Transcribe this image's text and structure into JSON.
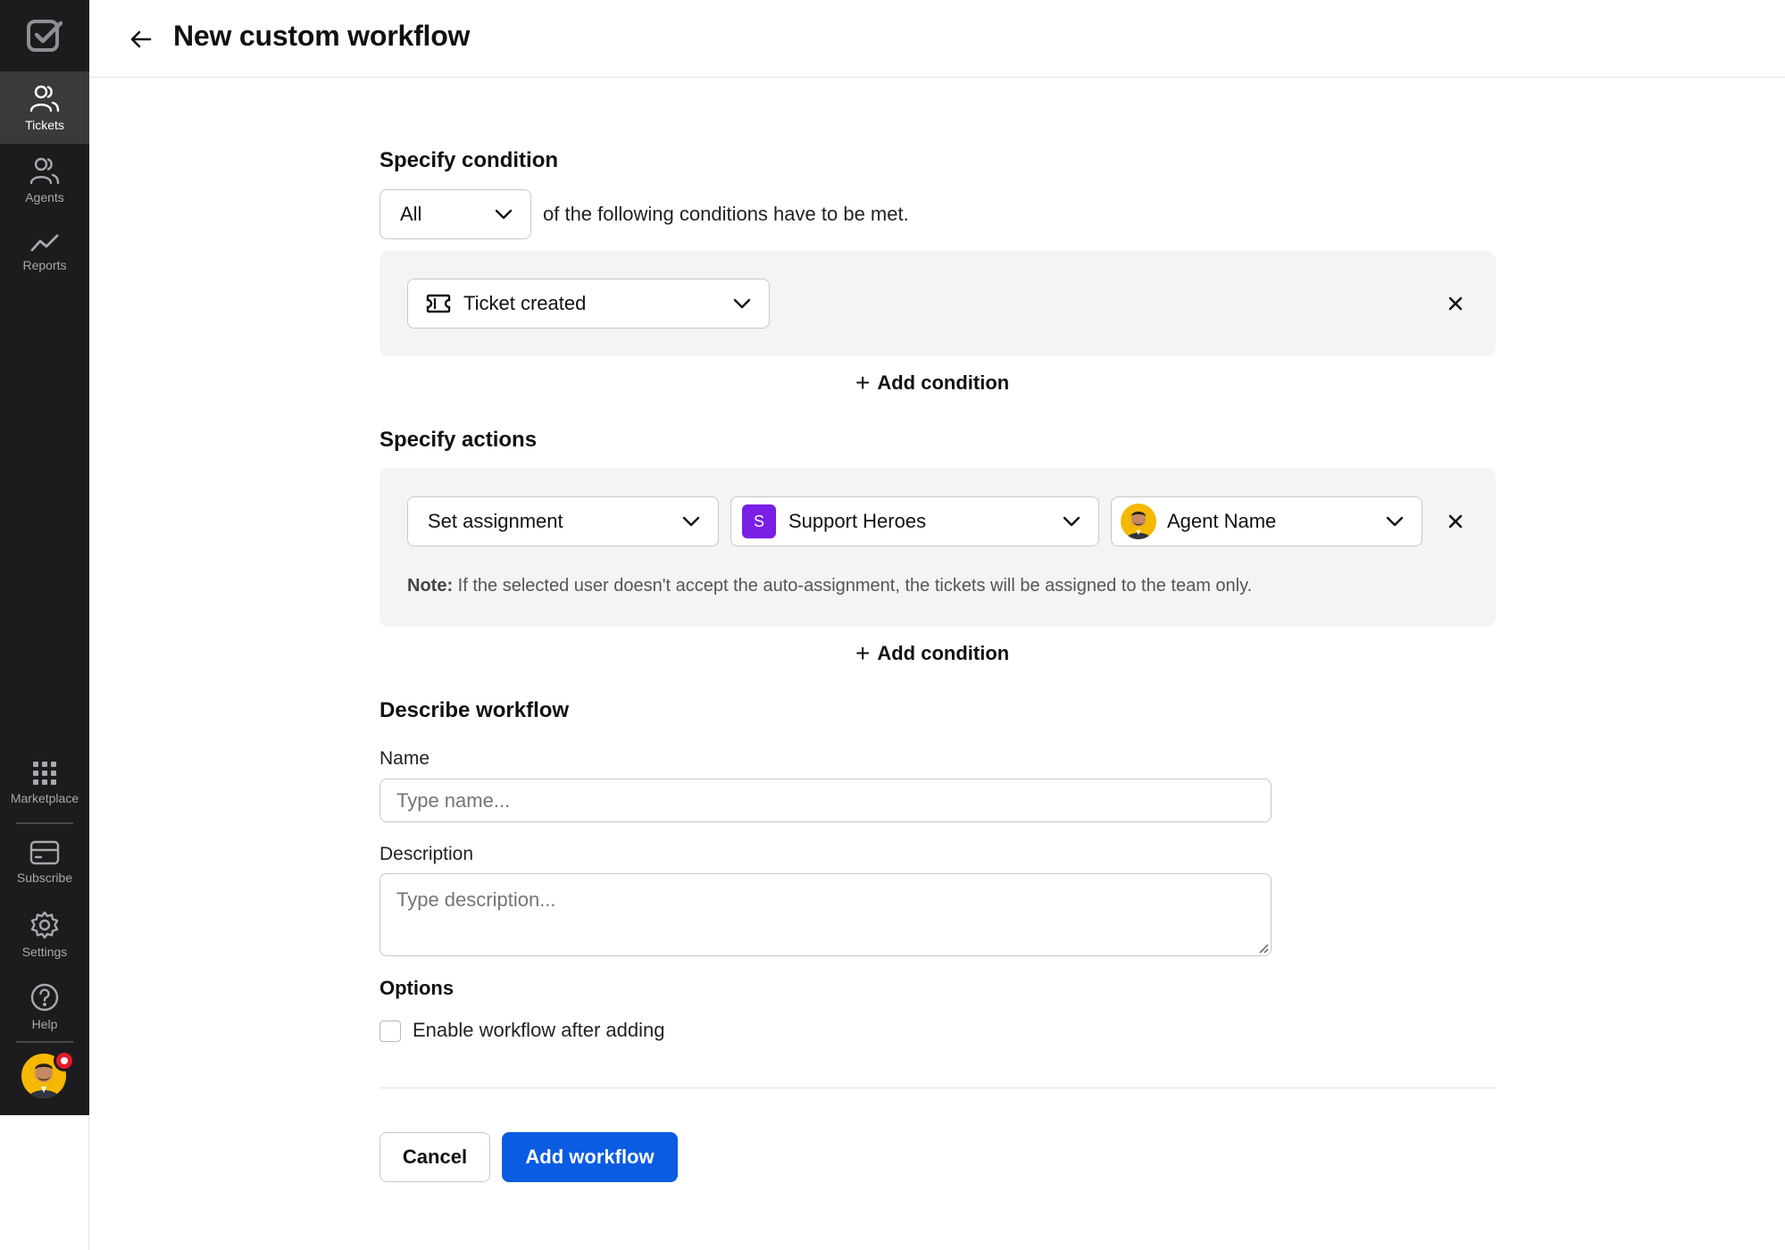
{
  "sidebar": {
    "items": [
      {
        "label": "Tickets",
        "icon": "users-icon"
      },
      {
        "label": "Agents",
        "icon": "users-icon"
      },
      {
        "label": "Reports",
        "icon": "trend-icon"
      },
      {
        "label": "Marketplace",
        "icon": "grid-icon"
      },
      {
        "label": "Subscribe",
        "icon": "card-icon"
      },
      {
        "label": "Settings",
        "icon": "gear-icon"
      },
      {
        "label": "Help",
        "icon": "help-icon"
      }
    ],
    "active": "Tickets"
  },
  "header": {
    "title": "New custom workflow"
  },
  "condition": {
    "title": "Specify condition",
    "quantifier": "All",
    "quantifier_suffix": "of the following conditions have to be met.",
    "trigger": "Ticket created",
    "add_label": "Add condition"
  },
  "actions": {
    "title": "Specify actions",
    "action": "Set assignment",
    "team": "Support Heroes",
    "team_initial": "S",
    "agent": "Agent Name",
    "note_label": "Note:",
    "note_text": "If the selected user doesn't accept the auto-assignment, the tickets will be assigned to the team only.",
    "add_label": "Add condition"
  },
  "describe": {
    "title": "Describe workflow",
    "name_label": "Name",
    "name_placeholder": "Type name...",
    "description_label": "Description",
    "description_placeholder": "Type description..."
  },
  "options": {
    "title": "Options",
    "enable_label": "Enable workflow after adding",
    "enable_checked": false
  },
  "footer": {
    "cancel": "Cancel",
    "submit": "Add workflow"
  },
  "colors": {
    "primary": "#0a5ce0",
    "team": "#7a1fe6",
    "sidebar": "#1c1c1e",
    "badge": "#e5192b"
  }
}
